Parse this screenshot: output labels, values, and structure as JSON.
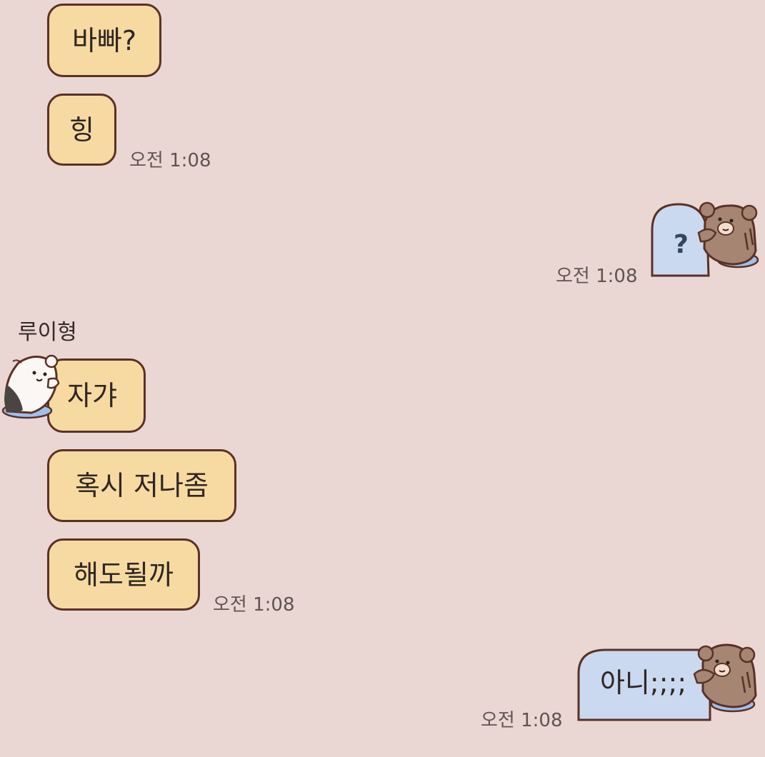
{
  "chat": {
    "messages": [
      {
        "id": "m1",
        "side": "left",
        "text": "바빠?"
      },
      {
        "id": "m2",
        "side": "left",
        "text": "힝",
        "time": "오전 1:08"
      },
      {
        "id": "m3",
        "side": "right",
        "text": "?",
        "time": "오전 1:08",
        "sticker": "bear-peek-icon"
      },
      {
        "id": "m4",
        "side": "left",
        "sender": "루이형",
        "text": "자갸",
        "sticker": "cat-peek-icon"
      },
      {
        "id": "m5",
        "side": "left",
        "text": "혹시 저나좀"
      },
      {
        "id": "m6",
        "side": "left",
        "text": "해도될까",
        "time": "오전 1:08"
      },
      {
        "id": "m7",
        "side": "right",
        "text": "아니;;;;",
        "time": "오전 1:08",
        "sticker": "bear-peek-icon"
      }
    ]
  },
  "colors": {
    "background": "#ead7d3",
    "received_bubble": "#f7daa1",
    "sent_bubble": "#cad9f0",
    "bubble_border": "#5a3127"
  }
}
